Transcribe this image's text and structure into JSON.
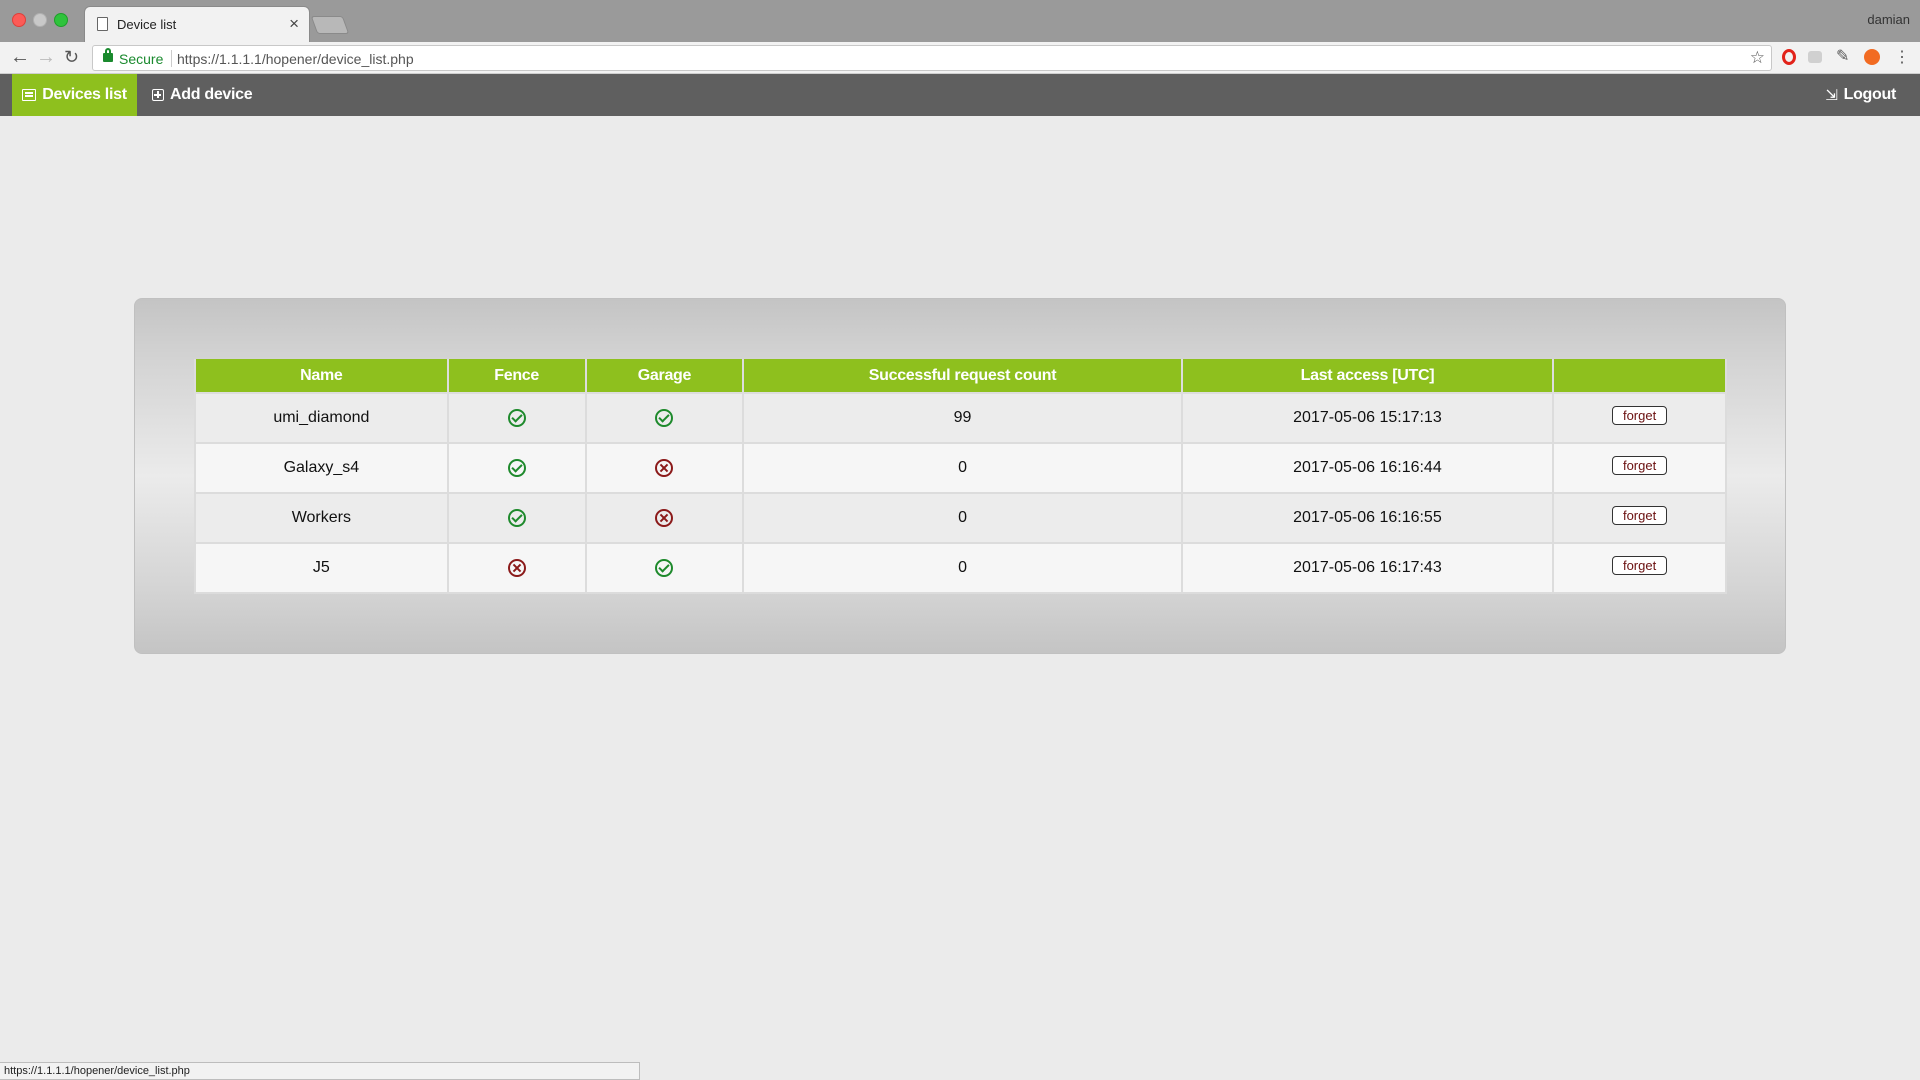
{
  "browser": {
    "tab_title": "Device list",
    "profile_name": "damian",
    "secure_label": "Secure",
    "url": "https://1.1.1.1/hopener/device_list.php",
    "status_url": "https://1.1.1.1/hopener/device_list.php",
    "extensions": [
      "opera-icon",
      "cast-icon",
      "eyedropper-icon",
      "adblock-icon"
    ]
  },
  "nav": {
    "devices_list": "Devices list",
    "add_device": "Add device",
    "logout": "Logout",
    "active_color": "#8ec01e",
    "bar_color": "#5f5f5f"
  },
  "table": {
    "headers": [
      "Name",
      "Fence",
      "Garage",
      "Successful request count",
      "Last access [UTC]",
      ""
    ],
    "rows": [
      {
        "name": "umi_diamond",
        "fence": "ok",
        "garage": "ok",
        "count": "99",
        "last_access": "2017-05-06 15:17:13",
        "action": "forget"
      },
      {
        "name": "Galaxy_s4",
        "fence": "ok",
        "garage": "fail",
        "count": "0",
        "last_access": "2017-05-06 16:16:44",
        "action": "forget"
      },
      {
        "name": "Workers",
        "fence": "ok",
        "garage": "fail",
        "count": "0",
        "last_access": "2017-05-06 16:16:55",
        "action": "forget"
      },
      {
        "name": "J5",
        "fence": "fail",
        "garage": "ok",
        "count": "0",
        "last_access": "2017-05-06 16:17:43",
        "action": "forget"
      }
    ],
    "status_colors": {
      "ok": "#1e8a2c",
      "fail": "#8b1a1a"
    }
  }
}
